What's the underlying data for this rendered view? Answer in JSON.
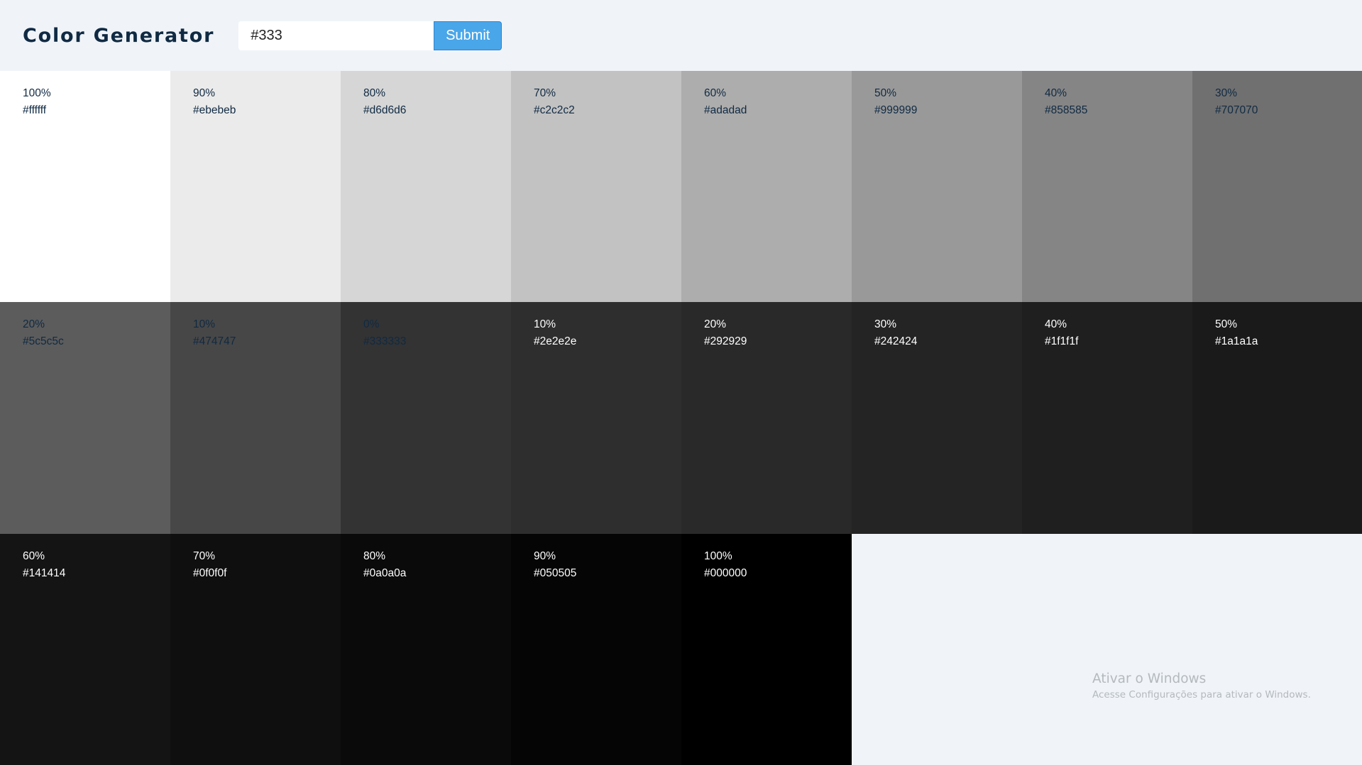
{
  "header": {
    "title": "Color Generator",
    "input_value": "#333",
    "submit_label": "Submit"
  },
  "colors": {
    "accent": "#49a6e9",
    "background": "#f0f4f8",
    "title_color": "#102a43"
  },
  "tiles": [
    {
      "percent": "100%",
      "hex": "#ffffff",
      "tone": "light"
    },
    {
      "percent": "90%",
      "hex": "#ebebeb",
      "tone": "light"
    },
    {
      "percent": "80%",
      "hex": "#d6d6d6",
      "tone": "light"
    },
    {
      "percent": "70%",
      "hex": "#c2c2c2",
      "tone": "light"
    },
    {
      "percent": "60%",
      "hex": "#adadad",
      "tone": "light"
    },
    {
      "percent": "50%",
      "hex": "#999999",
      "tone": "light"
    },
    {
      "percent": "40%",
      "hex": "#858585",
      "tone": "light"
    },
    {
      "percent": "30%",
      "hex": "#707070",
      "tone": "light"
    },
    {
      "percent": "20%",
      "hex": "#5c5c5c",
      "tone": "light"
    },
    {
      "percent": "10%",
      "hex": "#474747",
      "tone": "light"
    },
    {
      "percent": "0%",
      "hex": "#333333",
      "tone": "light"
    },
    {
      "percent": "10%",
      "hex": "#2e2e2e",
      "tone": "dark"
    },
    {
      "percent": "20%",
      "hex": "#292929",
      "tone": "dark"
    },
    {
      "percent": "30%",
      "hex": "#242424",
      "tone": "dark"
    },
    {
      "percent": "40%",
      "hex": "#1f1f1f",
      "tone": "dark"
    },
    {
      "percent": "50%",
      "hex": "#1a1a1a",
      "tone": "dark"
    },
    {
      "percent": "60%",
      "hex": "#141414",
      "tone": "dark"
    },
    {
      "percent": "70%",
      "hex": "#0f0f0f",
      "tone": "dark"
    },
    {
      "percent": "80%",
      "hex": "#0a0a0a",
      "tone": "dark"
    },
    {
      "percent": "90%",
      "hex": "#050505",
      "tone": "dark"
    },
    {
      "percent": "100%",
      "hex": "#000000",
      "tone": "dark"
    }
  ],
  "watermark": {
    "title": "Ativar o Windows",
    "subtitle": "Acesse Configurações para ativar o Windows."
  }
}
